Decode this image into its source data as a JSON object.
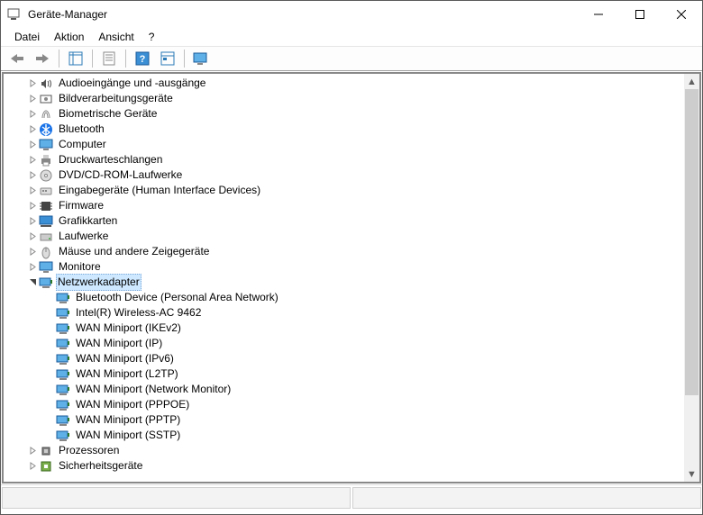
{
  "window": {
    "title": "Geräte-Manager"
  },
  "menu": {
    "file": "Datei",
    "action": "Aktion",
    "view": "Ansicht",
    "help": "?"
  },
  "toolbar": {
    "back": "back",
    "forward": "forward",
    "up_container": "up-container",
    "properties": "properties",
    "help": "help",
    "show_hidden": "show-hidden",
    "details": "details"
  },
  "tree": {
    "nodes": [
      {
        "depth": 1,
        "label": "Audioeingänge und -ausgänge",
        "icon": "speaker",
        "expandable": true,
        "expanded": false
      },
      {
        "depth": 1,
        "label": "Bildverarbeitungsgeräte",
        "icon": "imaging",
        "expandable": true,
        "expanded": false
      },
      {
        "depth": 1,
        "label": "Biometrische Geräte",
        "icon": "biometric",
        "expandable": true,
        "expanded": false
      },
      {
        "depth": 1,
        "label": "Bluetooth",
        "icon": "bluetooth",
        "expandable": true,
        "expanded": false
      },
      {
        "depth": 1,
        "label": "Computer",
        "icon": "monitor",
        "expandable": true,
        "expanded": false
      },
      {
        "depth": 1,
        "label": "Druckwarteschlangen",
        "icon": "printer",
        "expandable": true,
        "expanded": false
      },
      {
        "depth": 1,
        "label": "DVD/CD-ROM-Laufwerke",
        "icon": "disc",
        "expandable": true,
        "expanded": false
      },
      {
        "depth": 1,
        "label": "Eingabegeräte (Human Interface Devices)",
        "icon": "hid",
        "expandable": true,
        "expanded": false
      },
      {
        "depth": 1,
        "label": "Firmware",
        "icon": "chip",
        "expandable": true,
        "expanded": false
      },
      {
        "depth": 1,
        "label": "Grafikkarten",
        "icon": "display",
        "expandable": true,
        "expanded": false
      },
      {
        "depth": 1,
        "label": "Laufwerke",
        "icon": "drive",
        "expandable": true,
        "expanded": false
      },
      {
        "depth": 1,
        "label": "Mäuse und andere Zeigegeräte",
        "icon": "mouse",
        "expandable": true,
        "expanded": false
      },
      {
        "depth": 1,
        "label": "Monitore",
        "icon": "monitor",
        "expandable": true,
        "expanded": false
      },
      {
        "depth": 1,
        "label": "Netzwerkadapter",
        "icon": "nic",
        "expandable": true,
        "expanded": true,
        "selected": true
      },
      {
        "depth": 2,
        "label": "Bluetooth Device (Personal Area Network)",
        "icon": "nic",
        "expandable": false
      },
      {
        "depth": 2,
        "label": "Intel(R) Wireless-AC 9462",
        "icon": "nic",
        "expandable": false
      },
      {
        "depth": 2,
        "label": "WAN Miniport (IKEv2)",
        "icon": "nic",
        "expandable": false
      },
      {
        "depth": 2,
        "label": "WAN Miniport (IP)",
        "icon": "nic",
        "expandable": false
      },
      {
        "depth": 2,
        "label": "WAN Miniport (IPv6)",
        "icon": "nic",
        "expandable": false
      },
      {
        "depth": 2,
        "label": "WAN Miniport (L2TP)",
        "icon": "nic",
        "expandable": false
      },
      {
        "depth": 2,
        "label": "WAN Miniport (Network Monitor)",
        "icon": "nic",
        "expandable": false
      },
      {
        "depth": 2,
        "label": "WAN Miniport (PPPOE)",
        "icon": "nic",
        "expandable": false
      },
      {
        "depth": 2,
        "label": "WAN Miniport (PPTP)",
        "icon": "nic",
        "expandable": false
      },
      {
        "depth": 2,
        "label": "WAN Miniport (SSTP)",
        "icon": "nic",
        "expandable": false
      },
      {
        "depth": 1,
        "label": "Prozessoren",
        "icon": "cpu",
        "expandable": true,
        "expanded": false
      },
      {
        "depth": 1,
        "label": "Sicherheitsgeräte",
        "icon": "security",
        "expandable": true,
        "expanded": false
      }
    ]
  }
}
